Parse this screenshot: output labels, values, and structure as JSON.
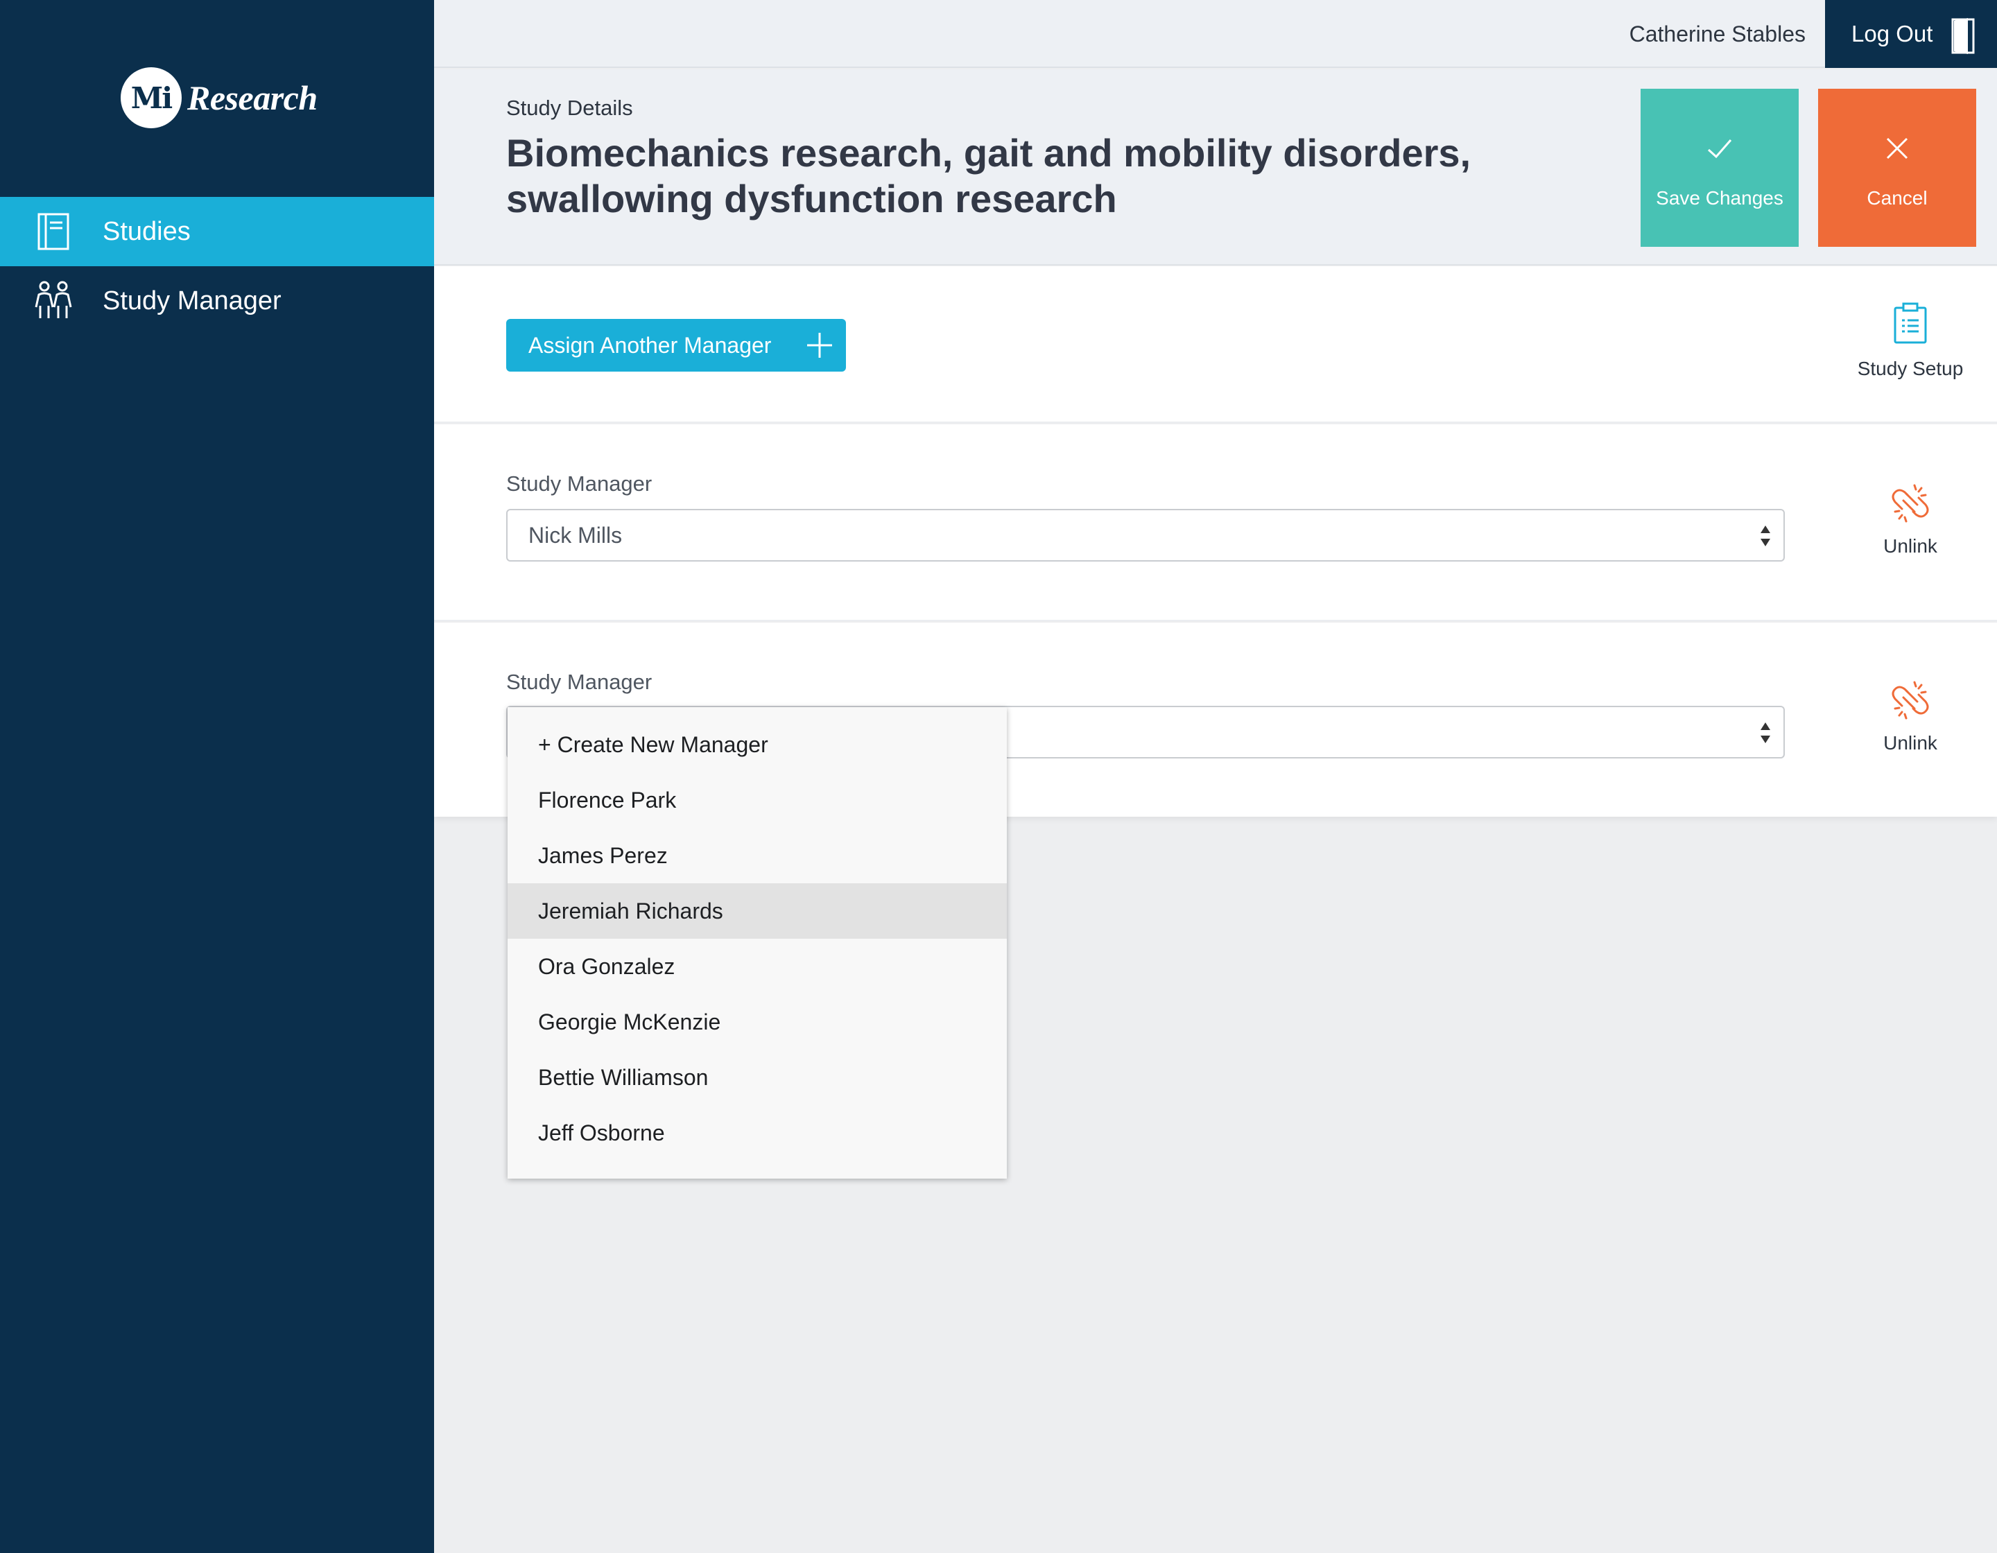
{
  "app": {
    "logo_mark": "Mi",
    "logo_text": "Research"
  },
  "sidebar": {
    "items": [
      {
        "label": "Studies",
        "icon": "notebook-icon",
        "active": true
      },
      {
        "label": "Study Manager",
        "icon": "people-icon",
        "active": false
      }
    ]
  },
  "topbar": {
    "user_name": "Catherine Stables",
    "logout_label": "Log Out",
    "logout_icon": "door-icon"
  },
  "header": {
    "breadcrumb": "Study Details",
    "title": "Biomechanics research, gait and mobility disorders, swallowing dysfunction research",
    "save_label": "Save Changes",
    "cancel_label": "Cancel"
  },
  "toolbar": {
    "assign_label": "Assign Another Manager",
    "study_setup_label": "Study Setup"
  },
  "managers": [
    {
      "label": "Study Manager",
      "value": "Nick Mills",
      "unlink_label": "Unlink"
    },
    {
      "label": "Study Manager",
      "value": "",
      "unlink_label": "Unlink"
    }
  ],
  "dropdown": {
    "options": [
      "+ Create New Manager",
      "Florence Park",
      "James Perez",
      "Jeremiah Richards",
      "Ora Gonzalez",
      "Georgie McKenzie",
      "Bettie Williamson",
      "Jeff Osborne"
    ],
    "highlighted": "Jeremiah Richards"
  },
  "colors": {
    "sidebar_bg": "#0b2f4c",
    "accent_blue": "#1aafd8",
    "save_green": "#48c2b4",
    "cancel_orange": "#ef6b38",
    "unlink_orange": "#ef6b38"
  }
}
